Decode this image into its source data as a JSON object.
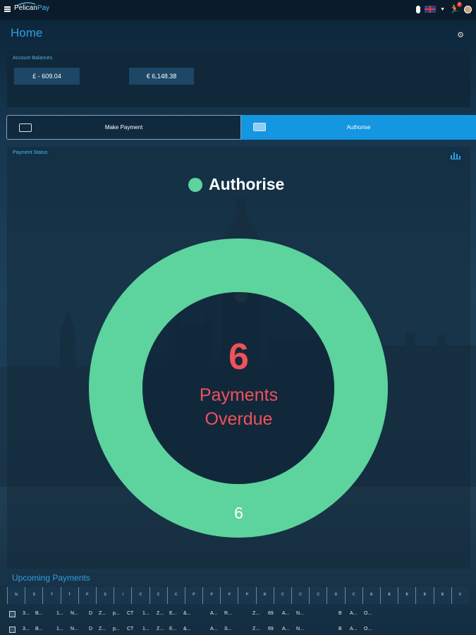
{
  "app": {
    "logo_text": "Pelican",
    "logo_accent": "Pay",
    "page_title": "Home"
  },
  "topbar": {
    "icons": [
      "menu-icon",
      "mic-icon",
      "uk-flag-icon",
      "chevron-down-icon",
      "runner-icon",
      "avatar"
    ],
    "notification_count": "2"
  },
  "balances": {
    "label": "Account Balances",
    "items": [
      {
        "text": "£ - 609.04"
      },
      {
        "text": "€ 6,148.38"
      }
    ]
  },
  "tabs": {
    "make_payment": "Make Payment",
    "authorise": "Authorise",
    "active": "Authorise"
  },
  "status": {
    "label": "Payment Status",
    "legend": "Authorise",
    "count": "6",
    "center_line1": "Payments",
    "center_line2": "Overdue",
    "slice_label": "6"
  },
  "chart_data": {
    "type": "pie",
    "categories": [
      "Authorise"
    ],
    "values": [
      6
    ],
    "colors": [
      "#5dd39e"
    ],
    "title": "",
    "center_text": "6 Payments Overdue"
  },
  "upcoming": {
    "title": "Upcoming Payments",
    "headers": [
      "N",
      "S",
      "T",
      "T",
      "P",
      "S",
      "I",
      "C",
      "C",
      "C",
      "P",
      "P",
      "P",
      "P",
      "R",
      "C",
      "C",
      "C",
      "D",
      "C",
      "B",
      "B",
      "B",
      "B",
      "B",
      "F"
    ],
    "rows": [
      [
        "3...",
        "B...",
        "1...",
        "N...",
        "D",
        "Z...",
        "p...",
        "CT",
        "1...",
        "Z...",
        "E...",
        "&...",
        "A...",
        "R...",
        "Z...",
        "69",
        "A...",
        "N...",
        "B",
        "A...",
        "O..."
      ],
      [
        "3...",
        "B...",
        "1...",
        "N...",
        "D",
        "Z...",
        "p...",
        "CT",
        "1...",
        "Z...",
        "E...",
        "&...",
        "A...",
        "S...",
        "Z...",
        "69",
        "A...",
        "N...",
        "B",
        "A...",
        "O..."
      ]
    ]
  }
}
